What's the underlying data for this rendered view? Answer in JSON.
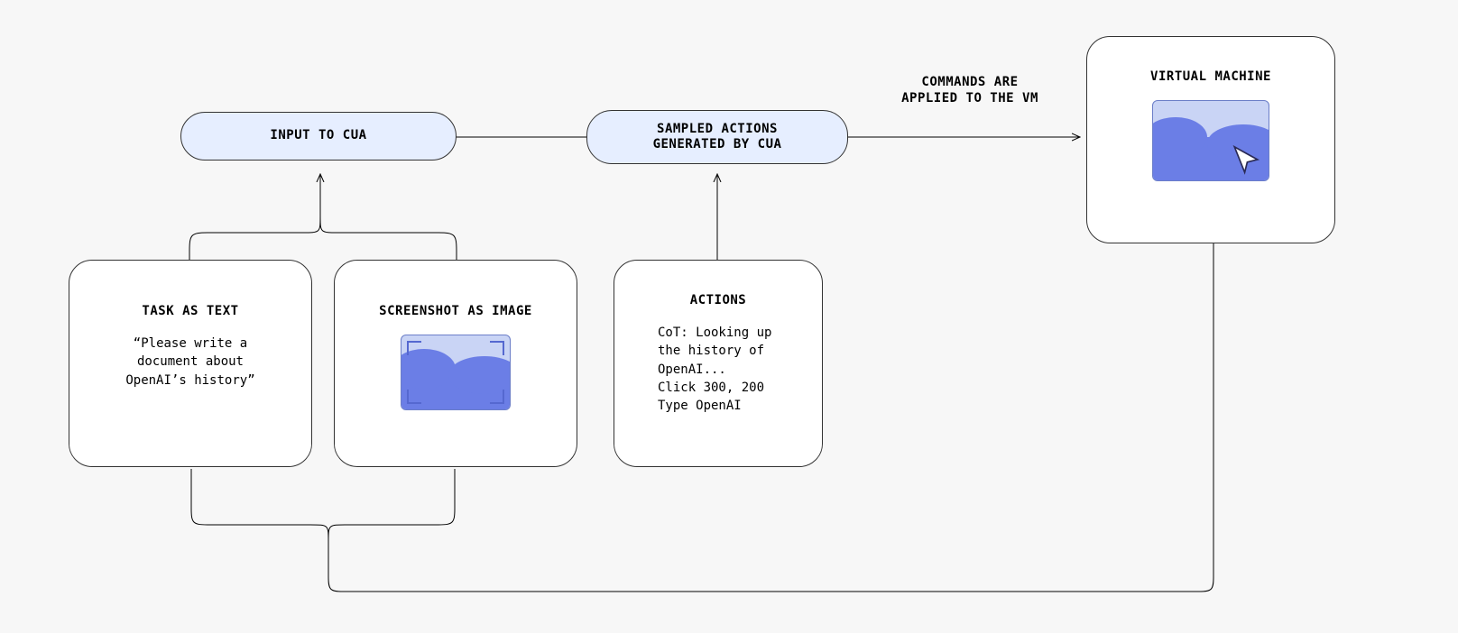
{
  "nodes": {
    "input_pill": {
      "label": "INPUT TO CUA"
    },
    "sampled_pill": {
      "label": "SAMPLED ACTIONS\nGENERATED BY CUA"
    },
    "task_card": {
      "title": "TASK AS TEXT",
      "body": "“Please write a\ndocument about\nOpenAI’s history”"
    },
    "screenshot_card": {
      "title": "SCREENSHOT AS IMAGE"
    },
    "actions_card": {
      "title": "ACTIONS",
      "body": "CoT: Looking up\nthe history of\nOpenAI...\nClick 300, 200\nType OpenAI"
    },
    "vm_card": {
      "title": "VIRTUAL MACHINE"
    }
  },
  "edges": {
    "commands_label": "COMMANDS ARE\nAPPLIED TO THE VM"
  }
}
